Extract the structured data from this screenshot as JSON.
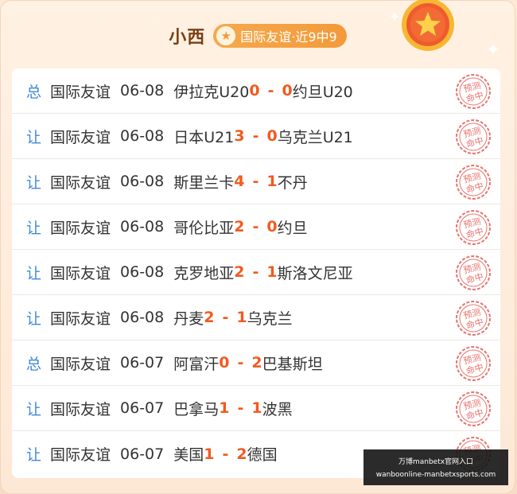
{
  "header": {
    "author": "小西",
    "badge_text": "国际友谊·近9中9",
    "badge_icon": "star-icon"
  },
  "stamp_text": "预测命中",
  "colors": {
    "tag": "#3f88d9",
    "score": "#f25a1f",
    "stamp": "#e8736e",
    "badge": "#f39a3a"
  },
  "records": [
    {
      "tag": "总",
      "league": "国际友谊",
      "date": "06-08",
      "home": "伊拉克U20",
      "home_score": "0",
      "sep": "-",
      "away_score": "0",
      "away": "约旦U20"
    },
    {
      "tag": "让",
      "league": "国际友谊",
      "date": "06-08",
      "home": "日本U21",
      "home_score": "3",
      "sep": "-",
      "away_score": "0",
      "away": "乌克兰U21"
    },
    {
      "tag": "让",
      "league": "国际友谊",
      "date": "06-08",
      "home": "斯里兰卡",
      "home_score": "4",
      "sep": "-",
      "away_score": "1",
      "away": "不丹"
    },
    {
      "tag": "让",
      "league": "国际友谊",
      "date": "06-08",
      "home": "哥伦比亚",
      "home_score": "2",
      "sep": "-",
      "away_score": "0",
      "away": "约旦"
    },
    {
      "tag": "让",
      "league": "国际友谊",
      "date": "06-08",
      "home": "克罗地亚",
      "home_score": "2",
      "sep": "-",
      "away_score": "1",
      "away": "斯洛文尼亚"
    },
    {
      "tag": "让",
      "league": "国际友谊",
      "date": "06-08",
      "home": "丹麦",
      "home_score": "2",
      "sep": "-",
      "away_score": "1",
      "away": "乌克兰"
    },
    {
      "tag": "总",
      "league": "国际友谊",
      "date": "06-07",
      "home": "阿富汗",
      "home_score": "0",
      "sep": "-",
      "away_score": "2",
      "away": "巴基斯坦"
    },
    {
      "tag": "让",
      "league": "国际友谊",
      "date": "06-07",
      "home": "巴拿马",
      "home_score": "1",
      "sep": "-",
      "away_score": "1",
      "away": "波黑"
    },
    {
      "tag": "让",
      "league": "国际友谊",
      "date": "06-07",
      "home": "美国",
      "home_score": "1",
      "sep": "-",
      "away_score": "2",
      "away": "德国"
    }
  ],
  "watermark": {
    "line1": "万博manbetx官网入口",
    "line2": "wanboonline-manbetxsports.com"
  }
}
